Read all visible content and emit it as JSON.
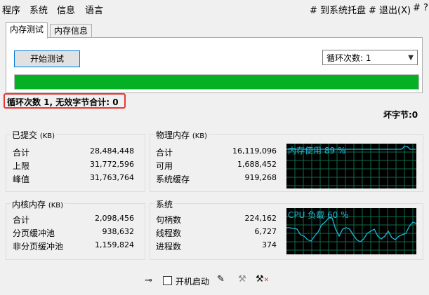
{
  "menu": {
    "left": [
      "程序",
      "系统",
      "信息",
      "语言"
    ],
    "right": [
      "# 到系统托盘",
      "# 退出(X)",
      "# ?"
    ]
  },
  "tabs": [
    "内存测试",
    "内存信息"
  ],
  "test": {
    "start_button": "开始测试",
    "loop_select": "循环次数: 1",
    "progress": 1.0
  },
  "status_text": "循环次数 1, 无效字节合计: 0",
  "bad_bytes": "坏字节:0",
  "committed": {
    "title": "已提交",
    "unit": "(KB)",
    "rows": [
      {
        "label": "合计",
        "value": "28,484,448"
      },
      {
        "label": "上限",
        "value": "31,772,596"
      },
      {
        "label": "峰值",
        "value": "31,763,764"
      }
    ]
  },
  "physical": {
    "title": "物理内存",
    "unit": "(KB)",
    "rows": [
      {
        "label": "合计",
        "value": "16,119,096"
      },
      {
        "label": "可用",
        "value": "1,688,452"
      },
      {
        "label": "系统缓存",
        "value": "919,268"
      }
    ],
    "graph_label": "内存使用 89 %"
  },
  "kernel": {
    "title": "内核内存",
    "unit": "(KB)",
    "rows": [
      {
        "label": "合计",
        "value": "2,098,456"
      },
      {
        "label": "分页缓冲池",
        "value": "938,632"
      },
      {
        "label": "非分页缓冲池",
        "value": "1,159,824"
      }
    ]
  },
  "system": {
    "title": "系统",
    "rows": [
      {
        "label": "句柄数",
        "value": "224,162"
      },
      {
        "label": "线程数",
        "value": "6,727"
      },
      {
        "label": "进程数",
        "value": "374"
      }
    ],
    "graph_label": "CPU 负载 60 %"
  },
  "footer": {
    "pin_icon": "pin-icon",
    "autostart_label": "开机启动",
    "edit_icon": "pen-icon",
    "tool_icon_1": "tools-icon",
    "tool_icon_2": "tools-alert-icon"
  },
  "colors": {
    "graph_bg": "#000000",
    "graph_grid": "#0f6b48",
    "graph_line": "#1fb9d8",
    "progress": "#06b025",
    "highlight": "#e53935"
  }
}
